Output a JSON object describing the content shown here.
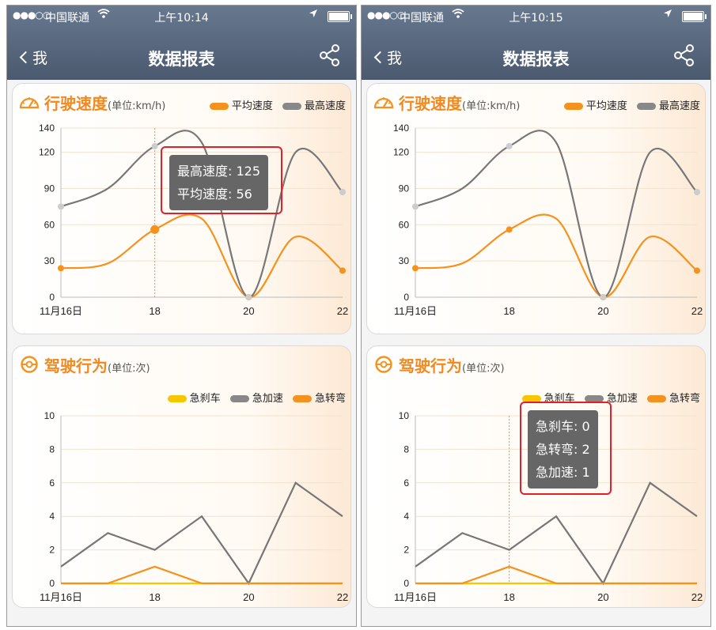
{
  "screens": [
    {
      "status": {
        "signal": "●●●○○",
        "carrier": "中国联通",
        "time": "上午10:14"
      },
      "nav": {
        "back": "我",
        "title": "数据报表"
      },
      "speed_card": {
        "title": "行驶速度",
        "unit": "(单位:km/h)"
      },
      "behavior_card": {
        "title": "驾驶行为",
        "unit": "(单位:次)"
      },
      "speed_tooltip": {
        "line1": "最高速度: 125",
        "line2": "平均速度: 56",
        "index": 2
      },
      "behavior_tooltip": null
    },
    {
      "status": {
        "signal": "●●●○○",
        "carrier": "中国联通",
        "time": "上午10:15"
      },
      "nav": {
        "back": "我",
        "title": "数据报表"
      },
      "speed_card": {
        "title": "行驶速度",
        "unit": "(单位:km/h)"
      },
      "behavior_card": {
        "title": "驾驶行为",
        "unit": "(单位:次)"
      },
      "speed_tooltip": null,
      "behavior_tooltip": {
        "line1": "急刹车: 0",
        "line2": "急转弯: 2",
        "line3": "急加速: 1",
        "index": 2
      }
    }
  ],
  "colors": {
    "orange": "#f5921e",
    "gray": "#777777",
    "yellow": "#f7c600",
    "highlight": "#e3202a",
    "header": "#56657b"
  },
  "chart_data": [
    {
      "type": "line",
      "title": "行驶速度",
      "unit": "单位:km/h",
      "x_tick_labels": [
        "11月16日",
        "18",
        "20",
        "22"
      ],
      "ylim": [
        0,
        140
      ],
      "y_ticks": [
        0,
        30,
        60,
        90,
        120,
        140
      ],
      "grid": true,
      "legend_position": "top-right",
      "series": [
        {
          "name": "平均速度",
          "color": "#f5921e",
          "values": [
            24,
            28,
            56,
            65,
            0,
            50,
            22
          ]
        },
        {
          "name": "最高速度",
          "color": "#777777",
          "values": [
            75,
            90,
            125,
            128,
            0,
            120,
            87
          ]
        }
      ]
    },
    {
      "type": "line",
      "title": "驾驶行为",
      "unit": "单位:次",
      "x_tick_labels": [
        "11月16日",
        "18",
        "20",
        "22"
      ],
      "ylim": [
        0,
        10
      ],
      "y_ticks": [
        0,
        2,
        4,
        6,
        8,
        10
      ],
      "grid": true,
      "legend_position": "top-right",
      "series": [
        {
          "name": "急刹车",
          "color": "#f7c600",
          "values": [
            0,
            0,
            0,
            0,
            0,
            0,
            0
          ]
        },
        {
          "name": "急加速",
          "color": "#777777",
          "values": [
            1,
            3,
            2,
            4,
            0,
            6,
            4
          ]
        },
        {
          "name": "急转弯",
          "color": "#f5921e",
          "values": [
            0,
            0,
            1,
            0,
            0,
            0,
            0
          ]
        }
      ]
    }
  ]
}
